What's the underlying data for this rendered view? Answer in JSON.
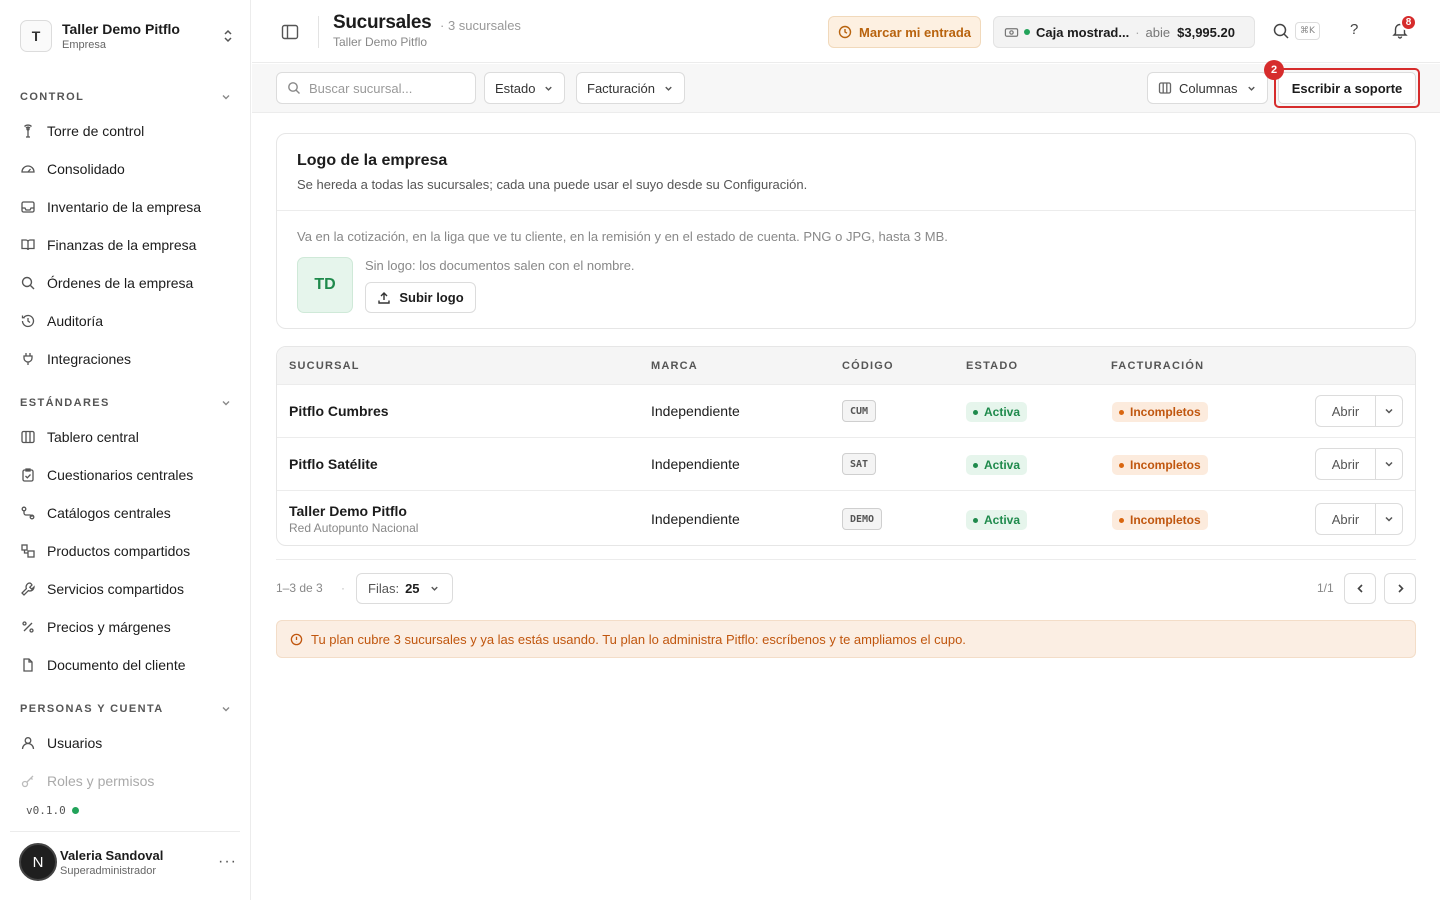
{
  "org": {
    "initial": "T",
    "name": "Taller Demo Pitflo",
    "type": "Empresa"
  },
  "sidebar": {
    "sections": [
      {
        "label": "CONTROL",
        "items": [
          {
            "label": "Torre de control",
            "icon": "tower-icon"
          },
          {
            "label": "Consolidado",
            "icon": "gauge-icon"
          },
          {
            "label": "Inventario de la empresa",
            "icon": "inbox-icon"
          },
          {
            "label": "Finanzas de la empresa",
            "icon": "book-icon"
          },
          {
            "label": "Órdenes de la empresa",
            "icon": "search-icon"
          },
          {
            "label": "Auditoría",
            "icon": "history-icon"
          },
          {
            "label": "Integraciones",
            "icon": "plug-icon"
          }
        ]
      },
      {
        "label": "ESTÁNDARES",
        "items": [
          {
            "label": "Tablero central",
            "icon": "columns-icon"
          },
          {
            "label": "Cuestionarios centrales",
            "icon": "clipboard-icon"
          },
          {
            "label": "Catálogos centrales",
            "icon": "route-icon"
          },
          {
            "label": "Productos compartidos",
            "icon": "boxes-icon"
          },
          {
            "label": "Servicios compartidos",
            "icon": "wrench-icon"
          },
          {
            "label": "Precios y márgenes",
            "icon": "percent-icon"
          },
          {
            "label": "Documento del cliente",
            "icon": "file-icon"
          }
        ]
      },
      {
        "label": "PERSONAS Y CUENTA",
        "items": [
          {
            "label": "Usuarios",
            "icon": "user-icon"
          },
          {
            "label": "Roles y permisos",
            "icon": "key-icon"
          }
        ]
      }
    ],
    "version": "v0.1.0"
  },
  "user": {
    "initial": "N",
    "name": "Valeria Sandoval",
    "role": "Superadministrador"
  },
  "header": {
    "title": "Sucursales",
    "count": "· 3 sucursales",
    "subtitle": "Taller Demo Pitflo",
    "entry_button": "Marcar mi entrada",
    "cash": {
      "name": "Caja mostrad...",
      "sep": "·",
      "state": "abie",
      "amount": "$3,995.20"
    },
    "shortcut": "⌘K",
    "help": "?",
    "notifications": "8"
  },
  "toolbar": {
    "search_placeholder": "Buscar sucursal...",
    "filter_status": "Estado",
    "filter_billing": "Facturación",
    "columns": "Columnas",
    "support": "Escribir a soporte",
    "support_badge": "2"
  },
  "logo_card": {
    "title": "Logo de la empresa",
    "description": "Se hereda a todas las sucursales; cada una puede usar el suyo desde su Configuración.",
    "help": "Va en la cotización, en la liga que ve tu cliente, en la remisión y en el estado de cuenta. PNG o JPG, hasta 3 MB.",
    "initials": "TD",
    "no_logo": "Sin logo: los documentos salen con el nombre.",
    "upload": "Subir logo"
  },
  "table": {
    "columns": [
      "SUCURSAL",
      "MARCA",
      "CÓDIGO",
      "ESTADO",
      "FACTURACIÓN"
    ],
    "rows": [
      {
        "name": "Pitflo Cumbres",
        "sub": "",
        "brand": "Independiente",
        "code": "CUM",
        "status": "Activa",
        "billing": "Incompletos",
        "action": "Abrir"
      },
      {
        "name": "Pitflo Satélite",
        "sub": "",
        "brand": "Independiente",
        "code": "SAT",
        "status": "Activa",
        "billing": "Incompletos",
        "action": "Abrir"
      },
      {
        "name": "Taller Demo Pitflo",
        "sub": "Red Autopunto Nacional",
        "brand": "Independiente",
        "code": "DEMO",
        "status": "Activa",
        "billing": "Incompletos",
        "action": "Abrir"
      }
    ]
  },
  "pager": {
    "range": "1–3 de 3",
    "dot": "·",
    "rows_label": "Filas:",
    "rows_value": "25",
    "page": "1/1"
  },
  "alert": "Tu plan cubre 3 sucursales y ya las estás usando. Tu plan lo administra Pitflo: escríbenos y te ampliamos el cupo.",
  "colors": {
    "accent_red": "#d62c2c",
    "success": "#1f8a4c",
    "warning": "#c0560e"
  }
}
